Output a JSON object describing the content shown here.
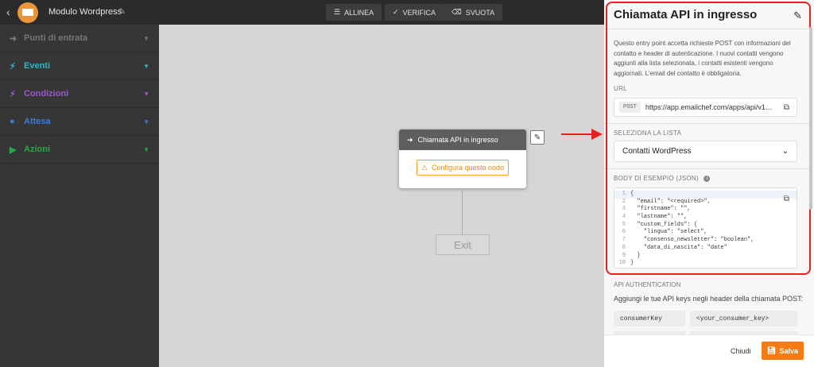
{
  "header": {
    "title": "Modulo Wordpress",
    "buttons": [
      {
        "label": "ALLINEA",
        "icon": "align-icon"
      },
      {
        "label": "VERIFICA",
        "icon": "check-icon"
      },
      {
        "label": "SVUOTA",
        "icon": "eraser-icon"
      }
    ]
  },
  "sidebar": {
    "items": [
      {
        "label": "Punti di entrata",
        "icon": "entry-icon",
        "color": "#777777"
      },
      {
        "label": "Eventi",
        "icon": "bolt-icon",
        "color": "#2bb8c5"
      },
      {
        "label": "Condizioni",
        "icon": "branch-icon",
        "color": "#9b59d0"
      },
      {
        "label": "Attesa",
        "icon": "clock-icon",
        "color": "#3b7ddd"
      },
      {
        "label": "Azioni",
        "icon": "play-icon",
        "color": "#27a844"
      }
    ]
  },
  "canvas": {
    "node_title": "Chiamata API in ingresso",
    "configure_label": "Configura questo nodo",
    "exit_label": "Exit"
  },
  "panel": {
    "title": "Chiamata API in ingresso",
    "description": "Questo entry point accetta richieste POST con informazioni del contatto e header di autenticazione. I nuovi contatti vengono aggiunti alla lista selezionata, i contatti esistenti vengono aggiornati. L'email del contatto è obbligatoria.",
    "url_label": "URL",
    "url_method": "POST",
    "url_value": "https://app.emailchef.com/apps/api/v1…",
    "list_label": "SELEZIONA LA LISTA",
    "list_value": "Contatti WordPress",
    "body_label": "BODY DI ESEMPIO (JSON)",
    "code_lines": [
      "{",
      "  \"email\": \"<required>\",",
      "  \"firstname\": \"\",",
      "  \"lastname\": \"\",",
      "  \"custom_fields\": {",
      "    \"lingua\": \"select\",",
      "    \"consenso_newsletter\": \"boolean\",",
      "    \"data_di_nascita\": \"date\"",
      "  }",
      "}"
    ],
    "auth_label": "API AUTHENTICATION",
    "auth_desc": "Aggiungi le tue API keys negli header della chiamata POST:",
    "auth_key": "consumerKey",
    "auth_value": "<your_consumer_key>",
    "close_label": "Chiudi",
    "save_label": "Salva",
    "accent_color": "#f57c14",
    "highlight_color": "#e52222"
  }
}
